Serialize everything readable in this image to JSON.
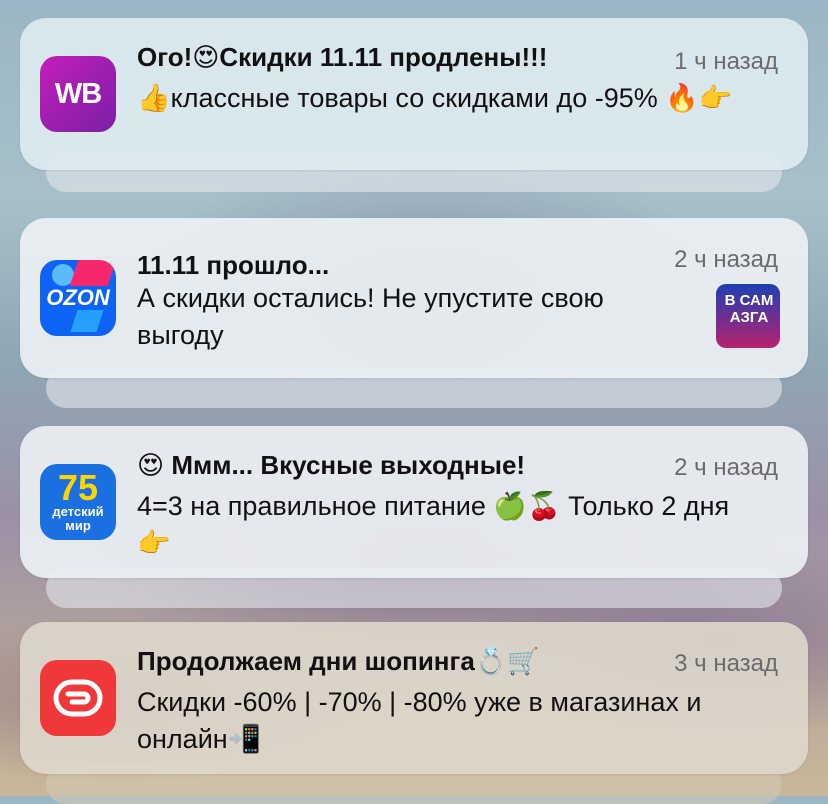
{
  "notifications": [
    {
      "app": "Wildberries",
      "icon_text": "WB",
      "title": "Ого!😍Скидки 11.11 продлены!!!",
      "time": "1 ч назад",
      "body": "👍классные товары со скидками до -95% 🔥👉"
    },
    {
      "app": "Ozon",
      "icon_text": "OZON",
      "title": "11.11 прошло...",
      "time": "2 ч назад",
      "body": "А скидки остались! Не упустите свою выгоду",
      "thumb_text": "В САМ АЗГА"
    },
    {
      "app": "Детский мир",
      "icon_text_top": "75",
      "icon_text_bottom": "детский мир",
      "title": "😍 Ммм... Вкусные выходные!",
      "time": "2 ч назад",
      "body": "4=3 на правильное питание 🍏🍒 Только 2 дня 👉"
    },
    {
      "app": "Спортмастер",
      "title": "Продолжаем дни шопинга💍🛒",
      "time": "3 ч назад",
      "body": "Скидки -60% | -70% | -80% уже в магазинах и онлайн📲"
    }
  ],
  "colors": {
    "wb": "#a11bb5",
    "ozon": "#0d63f3",
    "detmir": "#1a70e0",
    "sportmaster": "#f0383a"
  }
}
